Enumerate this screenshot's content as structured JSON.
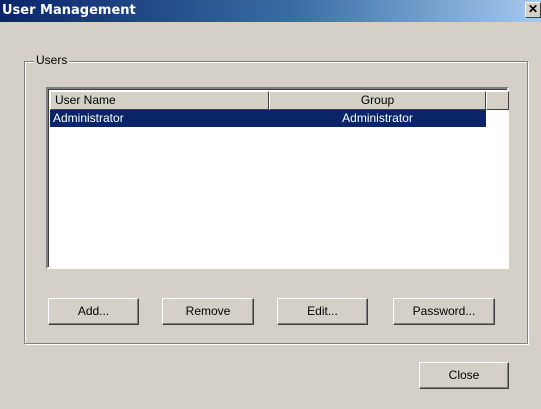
{
  "window": {
    "title": "User Management",
    "close_glyph": "✕"
  },
  "users_group": {
    "label": "Users"
  },
  "list": {
    "columns": [
      {
        "label": "User Name"
      },
      {
        "label": "Group"
      },
      {
        "label": ""
      }
    ],
    "rows": [
      {
        "user_name": "Administrator",
        "group": "Administrator",
        "selected": true
      }
    ]
  },
  "buttons": {
    "add": "Add...",
    "remove": "Remove",
    "edit": "Edit...",
    "password": "Password...",
    "close": "Close"
  },
  "colors": {
    "face": "#d4d0c8",
    "selection": "#0a246a",
    "title_gradient_start": "#0a246a"
  }
}
